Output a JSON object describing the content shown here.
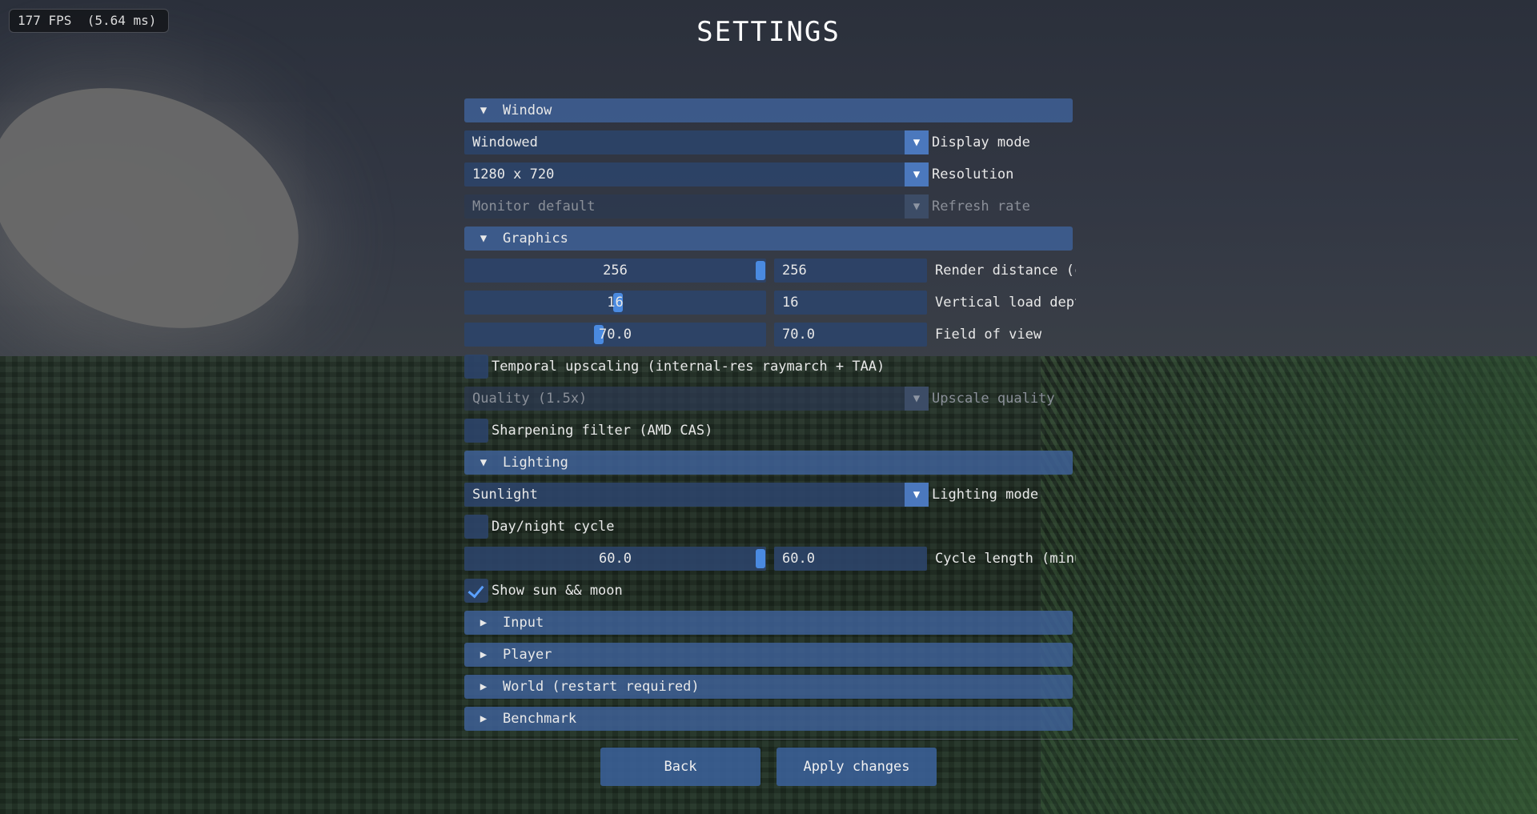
{
  "hud": {
    "fps": "177 FPS  (5.64 ms)"
  },
  "page": {
    "title": "SETTINGS"
  },
  "sections": {
    "window": {
      "label": "Window",
      "display_mode": {
        "value": "Windowed",
        "label": "Display mode"
      },
      "resolution": {
        "value": "1280 x 720",
        "label": "Resolution"
      },
      "refresh_rate": {
        "value": "Monitor default",
        "label": "Refresh rate",
        "disabled": true
      }
    },
    "graphics": {
      "label": "Graphics",
      "render_distance": {
        "slider_value": "256",
        "input_value": "256",
        "label": "Render distance (chunks)"
      },
      "vertical_load_depth": {
        "slider_value": "16",
        "input_value": "16",
        "label": "Vertical load depth"
      },
      "field_of_view": {
        "slider_value": "70.0",
        "input_value": "70.0",
        "label": "Field of view"
      },
      "temporal_upscaling": {
        "label": "Temporal upscaling (internal-res raymarch + TAA)",
        "checked": false
      },
      "upscale_quality": {
        "value": "Quality (1.5x)",
        "label": "Upscale quality",
        "disabled": true
      },
      "sharpening": {
        "label": "Sharpening filter (AMD CAS)",
        "checked": false
      }
    },
    "lighting": {
      "label": "Lighting",
      "lighting_mode": {
        "value": "Sunlight",
        "label": "Lighting mode"
      },
      "day_night": {
        "label": "Day/night cycle",
        "checked": false
      },
      "cycle_length": {
        "slider_value": "60.0",
        "input_value": "60.0",
        "label": "Cycle length (minutes)"
      },
      "show_sun_moon": {
        "label": "Show sun && moon",
        "checked": true
      }
    },
    "collapsed": {
      "input": "Input",
      "player": "Player",
      "world": "World (restart required)",
      "benchmark": "Benchmark"
    }
  },
  "icons": {
    "expanded": "triangle-down-icon",
    "collapsed": "triangle-right-icon",
    "dropdown": "dropdown-arrow-icon",
    "check": "checkmark-icon"
  },
  "glyphs": {
    "expanded": "▼",
    "collapsed": "▶",
    "dropdown": "▼"
  },
  "footer": {
    "back": "Back",
    "apply": "Apply changes"
  },
  "colors": {
    "accent": "#4a8ae0",
    "header": "#3e6096",
    "widget": "#2c4469"
  }
}
